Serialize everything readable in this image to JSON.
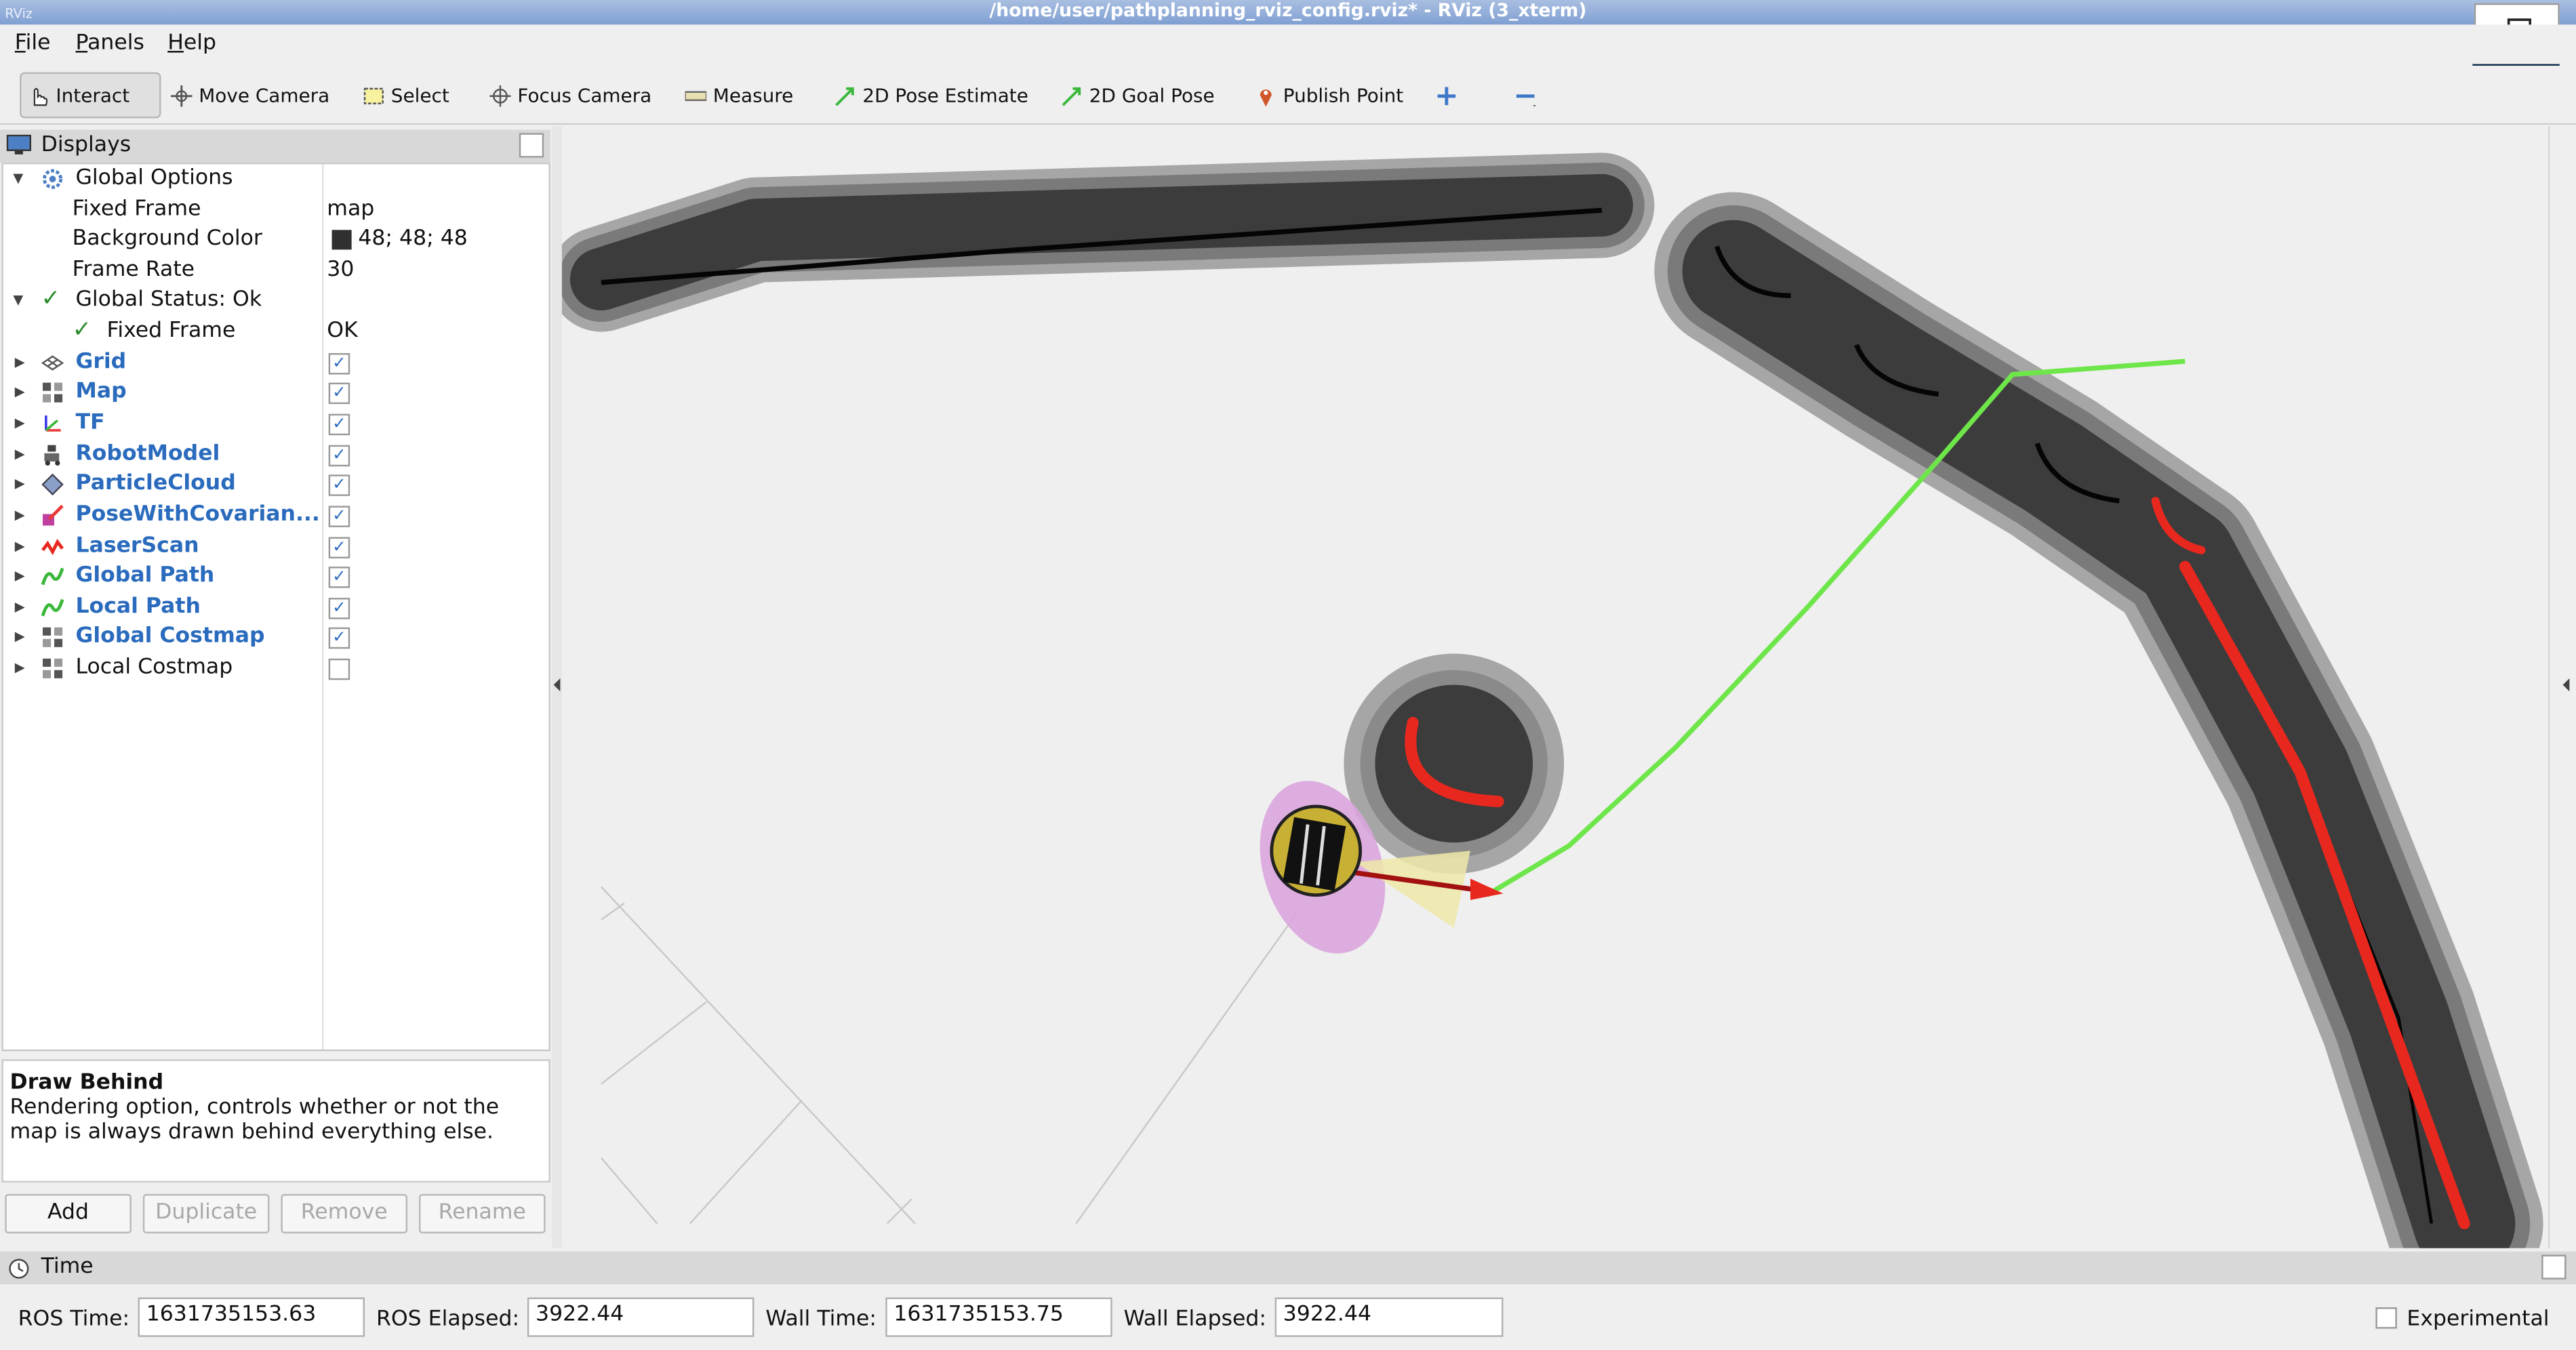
{
  "window": {
    "title": "/home/user/pathplanning_rviz_config.rviz* - RViz (3_xterm)",
    "app_icon": "RViz"
  },
  "menu": [
    "File",
    "Panels",
    "Help"
  ],
  "toolbar": {
    "interact": "Interact",
    "move_camera": "Move Camera",
    "select": "Select",
    "focus_camera": "Focus Camera",
    "measure": "Measure",
    "pose_estimate": "2D Pose Estimate",
    "goal_pose": "2D Goal Pose",
    "publish_point": "Publish Point"
  },
  "displays": {
    "title": "Displays",
    "global_options": "Global Options",
    "fixed_frame_label": "Fixed Frame",
    "fixed_frame_value": "map",
    "bg_color_label": "Background Color",
    "bg_color_value": "48; 48; 48",
    "bg_color_swatch": "#303030",
    "frame_rate_label": "Frame Rate",
    "frame_rate_value": "30",
    "global_status": "Global Status: Ok",
    "status_fixed_frame_label": "Fixed Frame",
    "status_fixed_frame_value": "OK",
    "items": [
      {
        "label": "Grid",
        "checked": true,
        "icon": "grid-icon"
      },
      {
        "label": "Map",
        "checked": true,
        "icon": "map-icon"
      },
      {
        "label": "TF",
        "checked": true,
        "icon": "tf-icon"
      },
      {
        "label": "RobotModel",
        "checked": true,
        "icon": "robot-model-icon"
      },
      {
        "label": "ParticleCloud",
        "checked": true,
        "icon": "particle-cloud-icon"
      },
      {
        "label": "PoseWithCovarian...",
        "checked": true,
        "icon": "pose-covariance-icon"
      },
      {
        "label": "LaserScan",
        "checked": true,
        "icon": "laser-scan-icon"
      },
      {
        "label": "Global Path",
        "checked": true,
        "icon": "path-icon"
      },
      {
        "label": "Local Path",
        "checked": true,
        "icon": "path-icon"
      },
      {
        "label": "Global Costmap",
        "checked": true,
        "icon": "map-icon"
      },
      {
        "label": "Local Costmap",
        "checked": false,
        "icon": "map-icon"
      }
    ]
  },
  "description": {
    "title": "Draw Behind",
    "text": "Rendering option, controls whether or not the map is always drawn behind everything else."
  },
  "buttons": {
    "add": "Add",
    "duplicate": "Duplicate",
    "remove": "Remove",
    "rename": "Rename"
  },
  "time": {
    "title": "Time",
    "ros_time_label": "ROS Time:",
    "ros_time": "1631735153.63",
    "ros_elapsed_label": "ROS Elapsed:",
    "ros_elapsed": "3922.44",
    "wall_time_label": "Wall Time:",
    "wall_time": "1631735153.75",
    "wall_elapsed_label": "Wall Elapsed:",
    "wall_elapsed": "3922.44",
    "experimental": "Experimental"
  },
  "colors": {
    "path": "#6ee64a",
    "laser": "#e8281e",
    "costmap_core": "#2a2a2a",
    "covariance": "#d9a5dc"
  }
}
